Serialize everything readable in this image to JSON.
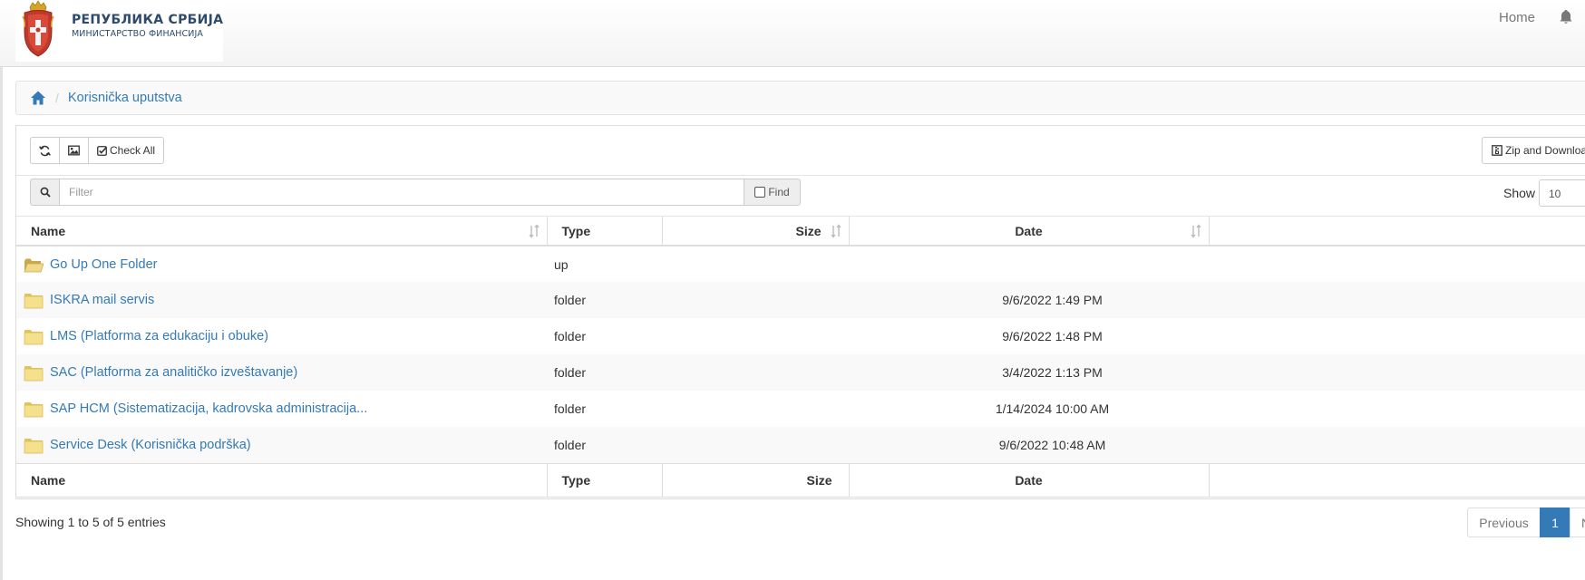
{
  "header": {
    "logo_title": "РЕПУБЛИКА СРБИЈА",
    "logo_subtitle": "МИНИСТАРСТВО ФИНАНСИЈА",
    "nav_home": "Home",
    "notifications_icon": "bell-icon"
  },
  "breadcrumb": {
    "home_icon": "home-icon",
    "separator": "/",
    "current": "Korisnička uputstva"
  },
  "toolbar": {
    "refresh_icon": "refresh-icon",
    "image_icon": "image-icon",
    "check_all_label": "Check All",
    "zip_label": "Zip and Download"
  },
  "filter": {
    "placeholder": "Filter",
    "find_label": "Find",
    "show_label": "Show",
    "show_value": "10"
  },
  "table": {
    "headers": {
      "name": "Name",
      "type": "Type",
      "size": "Size",
      "date": "Date"
    },
    "rows": [
      {
        "name": "Go Up One Folder",
        "type": "up",
        "size": "",
        "date": "",
        "icon": "open-folder-icon"
      },
      {
        "name": "ISKRA mail servis",
        "type": "folder",
        "size": "",
        "date": "9/6/2022 1:49 PM",
        "icon": "folder-icon"
      },
      {
        "name": "LMS (Platforma za edukaciju i obuke)",
        "type": "folder",
        "size": "",
        "date": "9/6/2022 1:48 PM",
        "icon": "folder-icon"
      },
      {
        "name": "SAC (Platforma za analitičko izveštavanje)",
        "type": "folder",
        "size": "",
        "date": "3/4/2022 1:13 PM",
        "icon": "folder-icon"
      },
      {
        "name": "SAP HCM (Sistematizacija, kadrovska administracija...",
        "type": "folder",
        "size": "",
        "date": "1/14/2024 10:00 AM",
        "icon": "folder-icon"
      },
      {
        "name": "Service Desk (Korisnička podrška)",
        "type": "folder",
        "size": "",
        "date": "9/6/2022 10:48 AM",
        "icon": "folder-icon"
      }
    ]
  },
  "footer": {
    "info": "Showing 1 to 5 of 5 entries",
    "prev_label": "Previous",
    "current_page": "1",
    "next_label": "Next"
  },
  "colors": {
    "link": "#337ab7",
    "active_page": "#337ab7",
    "logo_text": "#2c4a6e"
  }
}
